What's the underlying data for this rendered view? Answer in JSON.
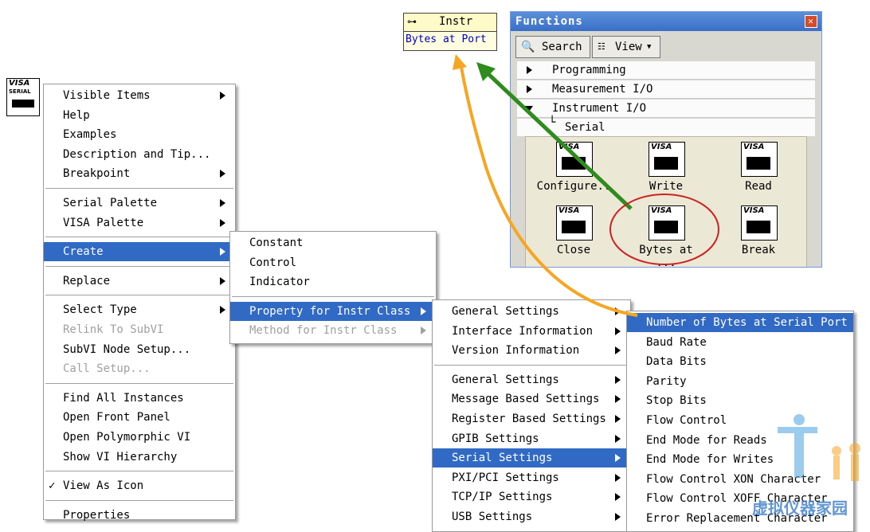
{
  "node": {
    "line1": "VISA",
    "line2": "SERIAL"
  },
  "property_node": {
    "title": "Instr",
    "property": "Bytes at Port"
  },
  "menu1": {
    "items": [
      {
        "label": "Visible Items",
        "sub": true
      },
      {
        "label": "Help"
      },
      {
        "label": "Examples"
      },
      {
        "label": "Description and Tip..."
      },
      {
        "label": "Breakpoint",
        "sub": true
      },
      {
        "label": "Serial Palette",
        "sub": true
      },
      {
        "label": "VISA Palette",
        "sub": true
      },
      {
        "label": "Create",
        "sub": true,
        "highlighted": true
      },
      {
        "label": "Replace",
        "sub": true
      },
      {
        "label": "Select Type",
        "sub": true
      },
      {
        "label": "Relink To SubVI",
        "disabled": true
      },
      {
        "label": "SubVI Node Setup..."
      },
      {
        "label": "Call Setup...",
        "disabled": true
      },
      {
        "label": "Find All Instances"
      },
      {
        "label": "Open Front Panel"
      },
      {
        "label": "Open Polymorphic VI"
      },
      {
        "label": "Show VI Hierarchy"
      },
      {
        "label": "View As Icon",
        "checked": true
      },
      {
        "label": "Properties"
      }
    ]
  },
  "menu2": {
    "items": [
      {
        "label": "Constant"
      },
      {
        "label": "Control"
      },
      {
        "label": "Indicator"
      },
      {
        "label": "Property for Instr Class",
        "sub": true,
        "highlighted": true
      },
      {
        "label": "Method for Instr Class",
        "sub": true,
        "disabled": true
      }
    ]
  },
  "menu3": {
    "items": [
      {
        "label": "General Settings",
        "sub": true
      },
      {
        "label": "Interface Information",
        "sub": true
      },
      {
        "label": "Version Information",
        "sub": true
      },
      {
        "label": "General Settings",
        "sub": true
      },
      {
        "label": "Message Based Settings",
        "sub": true
      },
      {
        "label": "Register Based Settings",
        "sub": true
      },
      {
        "label": "GPIB Settings",
        "sub": true
      },
      {
        "label": "Serial Settings",
        "sub": true,
        "highlighted": true
      },
      {
        "label": "PXI/PCI Settings",
        "sub": true
      },
      {
        "label": "TCP/IP Settings",
        "sub": true
      },
      {
        "label": "USB Settings",
        "sub": true
      }
    ]
  },
  "menu4": {
    "items": [
      {
        "label": "Number of Bytes at Serial Port",
        "highlighted": true
      },
      {
        "label": "Baud Rate"
      },
      {
        "label": "Data Bits"
      },
      {
        "label": "Parity"
      },
      {
        "label": "Stop Bits"
      },
      {
        "label": "Flow Control"
      },
      {
        "label": "End Mode for Reads"
      },
      {
        "label": "End Mode for Writes"
      },
      {
        "label": "Flow Control XON Character"
      },
      {
        "label": "Flow Control XOFF Character"
      },
      {
        "label": "Error Replacement Character"
      }
    ]
  },
  "functions": {
    "title": "Functions",
    "search": "Search",
    "view": "View",
    "categories": [
      "Programming",
      "Measurement I/O",
      "Instrument I/O"
    ],
    "subcategory": "Serial",
    "vis": [
      {
        "label": "Configure..",
        "icon_text": "VISA"
      },
      {
        "label": "Write",
        "icon_text": "VISA"
      },
      {
        "label": "Read",
        "icon_text": "VISA"
      },
      {
        "label": "Close",
        "icon_text": "VISA"
      },
      {
        "label": "Bytes at ...",
        "icon_text": "VISA"
      },
      {
        "label": "Break",
        "icon_text": "VISA"
      }
    ]
  },
  "watermark": "虚拟仪器家园",
  "colors": {
    "highlight": "#316ac5",
    "green_arrow": "#2e8b1e",
    "orange_arrow": "#f5a623",
    "circle": "#cc2222"
  }
}
